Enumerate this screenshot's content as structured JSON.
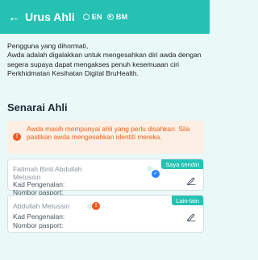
{
  "header": {
    "title": "Urus Ahli",
    "languages": [
      {
        "label": "EN",
        "selected": false
      },
      {
        "label": "BM",
        "selected": true
      }
    ]
  },
  "intro": {
    "line1": "Pengguna yang dihormati,",
    "line2": "Awda adalah digalakkan untuk mengesahkan diri awda dengan segera supaya dapat mengakses penuh kesemuaan ciri Perkhidmatan Kesihatan Digital BruHealth."
  },
  "section_title": "Senarai Ahli",
  "alert": {
    "text": "Awda masih mempunyai ahli yang perlu disahkan. Sila pastikan awda mengesahkan identiti mereka."
  },
  "members": [
    {
      "name": "Fatimah Binti Abdullah Metussin",
      "badge": "Saya sendiri",
      "kad_label": "Kad Pengenalan:",
      "kad_value": "",
      "pasport_label": "Nombor pasport:",
      "pasport_value": "",
      "status": "verified"
    },
    {
      "name": "Abdullah Metussin",
      "badge": "Lain-lain",
      "kad_label": "Kad Pengenalan:",
      "kad_value": "",
      "pasport_label": "Nombor pasport:",
      "pasport_value": "",
      "status": "unverified"
    }
  ],
  "colors": {
    "header": "#25c2b3",
    "background": "#e9f9f7",
    "alert_bg": "#fdefe4",
    "alert_text": "#e8631a",
    "badge": "#25c2b3",
    "verified": "#2b86ff",
    "warning": "#f15a24"
  },
  "icons": {
    "back": "arrow-left-icon",
    "alert": "exclamation-icon",
    "edit": "pencil-icon",
    "verified": "check-badge-icon"
  }
}
